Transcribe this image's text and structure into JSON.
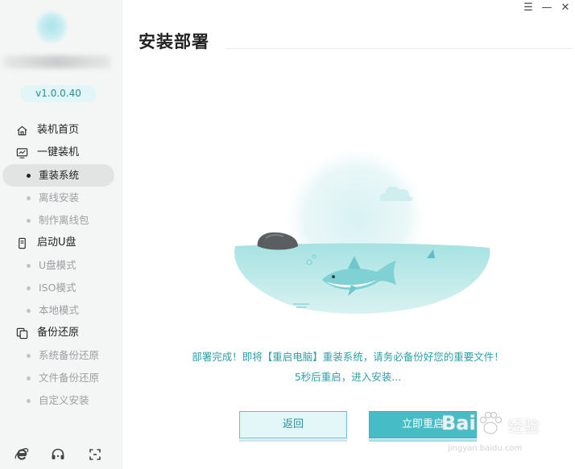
{
  "app": {
    "version": "v1.0.0.40"
  },
  "window_controls": {
    "menu": "☰",
    "minimize": "—",
    "close": "✕"
  },
  "sidebar": {
    "groups": [
      {
        "label": "装机首页",
        "icon": "home-icon",
        "subitems": []
      },
      {
        "label": "一键装机",
        "icon": "monitor-icon",
        "subitems": [
          {
            "label": "重装系统",
            "active": true
          },
          {
            "label": "离线安装",
            "active": false
          },
          {
            "label": "制作离线包",
            "active": false
          }
        ]
      },
      {
        "label": "启动U盘",
        "icon": "usb-icon",
        "subitems": [
          {
            "label": "U盘模式",
            "active": false
          },
          {
            "label": "ISO模式",
            "active": false
          },
          {
            "label": "本地模式",
            "active": false
          }
        ]
      },
      {
        "label": "备份还原",
        "icon": "backup-icon",
        "subitems": [
          {
            "label": "系统备份还原",
            "active": false
          },
          {
            "label": "文件备份还原",
            "active": false
          },
          {
            "label": "自定义安装",
            "active": false
          }
        ]
      }
    ],
    "bottom_icons": [
      "ie-browser-icon",
      "headset-support-icon",
      "fullscreen-icon"
    ]
  },
  "main": {
    "title": "安装部署",
    "message_line1": "部署完成！即将【重启电脑】重装系统，请务必备份好您的重要文件！",
    "message_line2": "5秒后重启，进入安装...",
    "countdown_seconds": 5,
    "back_button": "返回",
    "restart_button": "立即重启"
  },
  "watermark": {
    "brand": "Bai",
    "brand_suffix": "经验",
    "url": "jingyan.baidu.com"
  },
  "colors": {
    "accent": "#46bcc6",
    "accent_text": "#2d9fa7",
    "sidebar_bg": "#f4f6f6"
  }
}
